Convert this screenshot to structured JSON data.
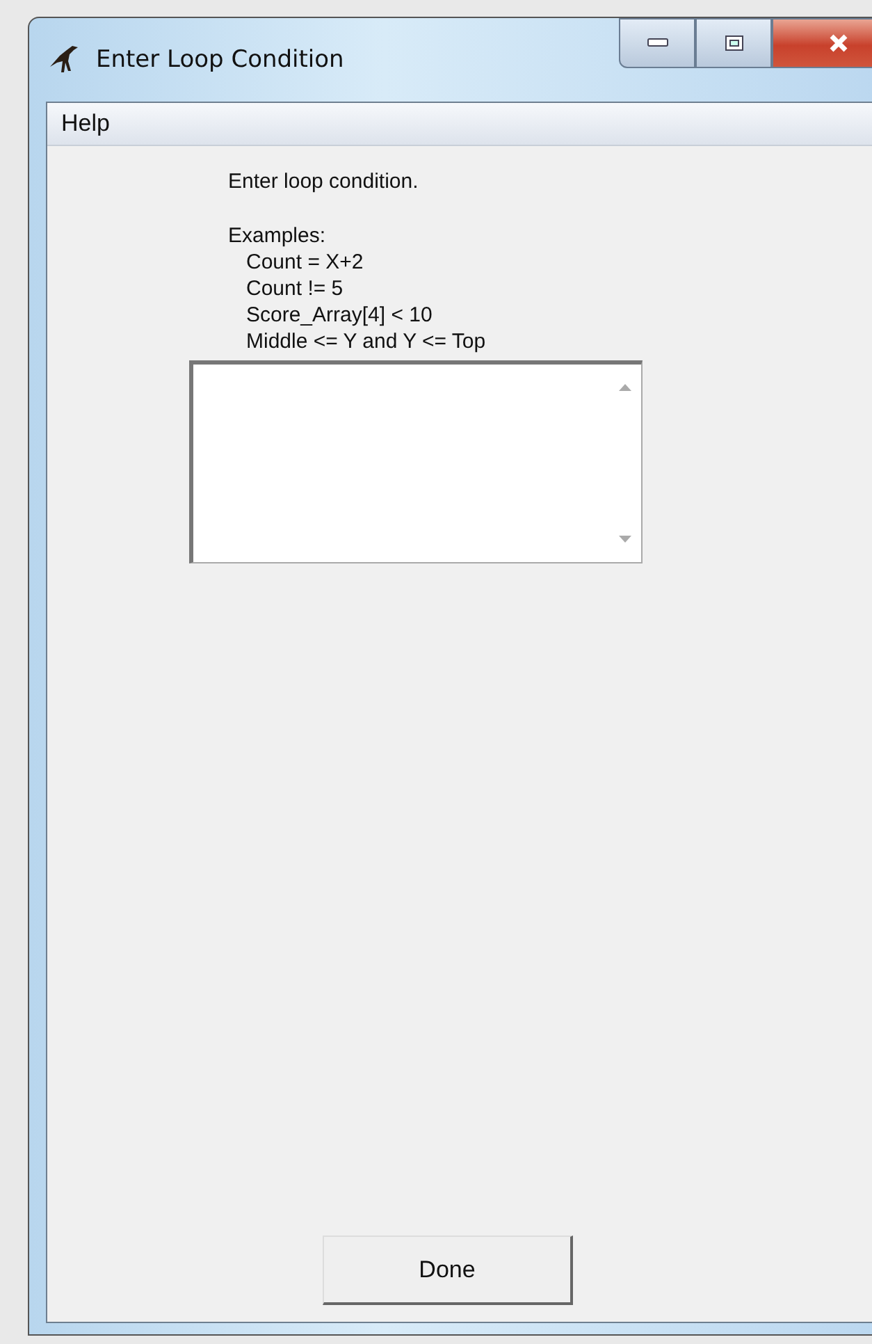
{
  "window": {
    "title": "Enter Loop Condition"
  },
  "menu": [
    {
      "label": "Help"
    }
  ],
  "prompt": "Enter loop condition.",
  "examples": {
    "heading": "Examples:",
    "items": [
      "Count = X+2",
      "Count != 5",
      "Score_Array[4] < 10",
      "Middle <= Y and Y <= Top"
    ]
  },
  "buttons": [
    {
      "label": "Done"
    }
  ]
}
